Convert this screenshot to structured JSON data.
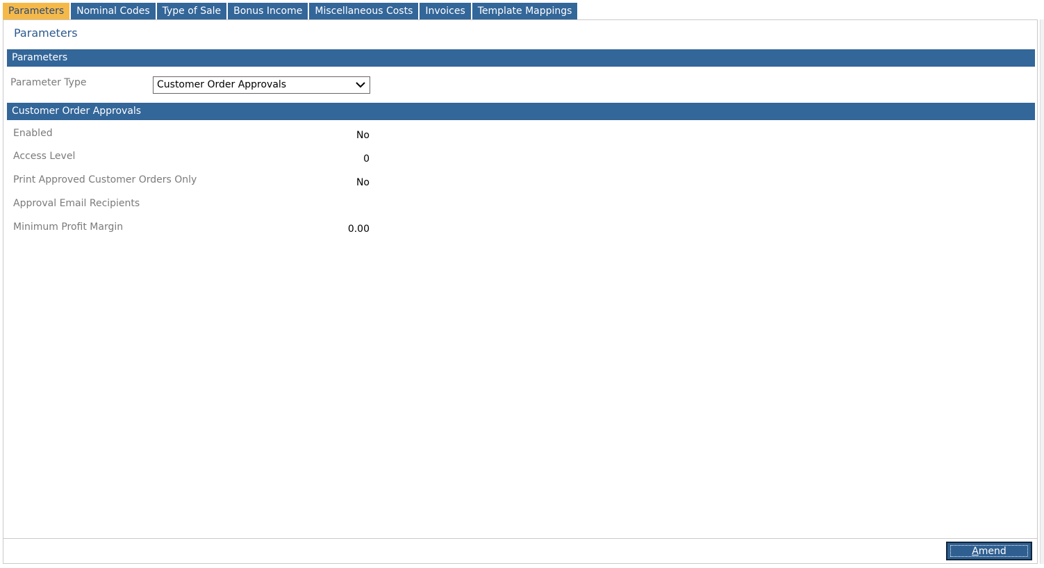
{
  "tabs": [
    {
      "label": "Parameters",
      "active": true
    },
    {
      "label": "Nominal Codes"
    },
    {
      "label": "Type of Sale"
    },
    {
      "label": "Bonus Income"
    },
    {
      "label": "Miscellaneous Costs"
    },
    {
      "label": "Invoices"
    },
    {
      "label": "Template Mappings"
    }
  ],
  "page": {
    "title": "Parameters"
  },
  "sections": {
    "parameters_header": "Parameters",
    "coa_header": "Customer Order Approvals"
  },
  "parameter_type": {
    "label": "Parameter Type",
    "selected": "Customer Order Approvals"
  },
  "fields": [
    {
      "label": "Enabled",
      "value": "No"
    },
    {
      "label": "Access Level",
      "value": "0"
    },
    {
      "label": "Print Approved Customer Orders Only",
      "value": "No"
    },
    {
      "label": "Approval Email Recipients",
      "value": ""
    },
    {
      "label": "Minimum Profit Margin",
      "value": "0.00"
    }
  ],
  "footer": {
    "amend_label_underlined": "A",
    "amend_label_rest": "mend"
  },
  "colors": {
    "tab_bg": "#336699",
    "tab_active_bg": "#f5b94a",
    "header_bg": "#336699",
    "button_bg": "#2f5f90"
  },
  "icons": {
    "dropdown": "chevron-down-icon"
  }
}
